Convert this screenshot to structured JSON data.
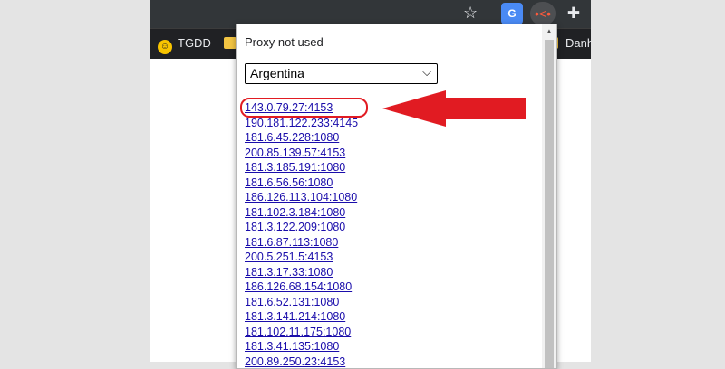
{
  "colors": {
    "highlight": "#e11b22",
    "link": "#1a0dab",
    "toolbar": "#323639",
    "bookmarks_bar": "#202124"
  },
  "toolbar": {
    "star_icon": "star-icon",
    "extensions": [
      {
        "name": "translate-icon",
        "glyph": "G"
      },
      {
        "name": "proxy-extension-icon",
        "glyph": "•<•"
      },
      {
        "name": "puzzle-icon",
        "glyph": "✚"
      }
    ]
  },
  "bookmarks": {
    "items": [
      {
        "label": "TGDĐ"
      },
      {
        "label": "Danh"
      }
    ]
  },
  "popup": {
    "status": "Proxy not used",
    "country_select": {
      "selected": "Argentina"
    },
    "proxies": [
      "143.0.79.27:4153",
      "190.181.122.233:4145",
      "181.6.45.228:1080",
      "200.85.139.57:4153",
      "181.3.185.191:1080",
      "181.6.56.56:1080",
      "186.126.113.104:1080",
      "181.102.3.184:1080",
      "181.3.122.209:1080",
      "181.6.87.113:1080",
      "200.5.251.5:4153",
      "181.3.17.33:1080",
      "186.126.68.154:1080",
      "181.6.52.131:1080",
      "181.3.141.214:1080",
      "181.102.11.175:1080",
      "181.3.41.135:1080",
      "200.89.250.23:4153"
    ],
    "highlighted_index": 0
  }
}
